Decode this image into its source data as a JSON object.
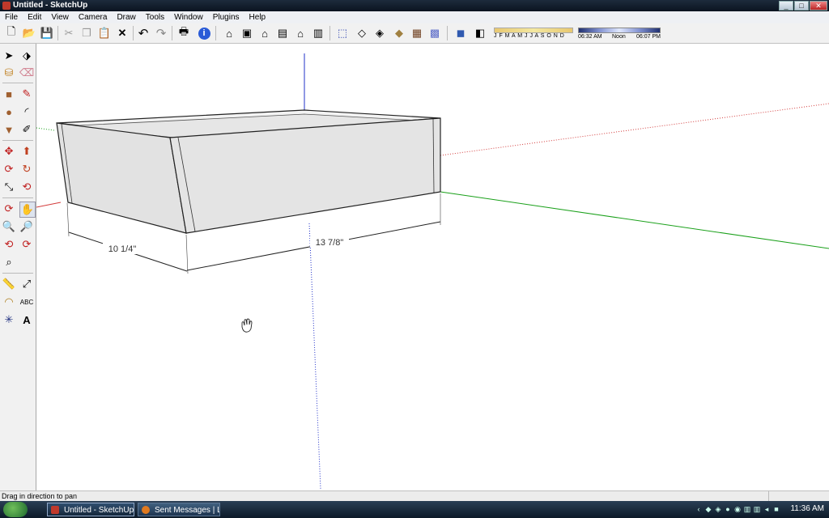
{
  "window": {
    "title": "Untitled - SketchUp"
  },
  "menus": [
    "File",
    "Edit",
    "View",
    "Camera",
    "Draw",
    "Tools",
    "Window",
    "Plugins",
    "Help"
  ],
  "shadow_settings": {
    "months_label": "J F M A M J J A S O N D",
    "time_left": "06:32 AM",
    "time_mid": "Noon",
    "time_right": "06:07 PM"
  },
  "viewport": {
    "dimensions": [
      "10 1/4\"",
      "13 7/8\""
    ],
    "axis_colors": {
      "red": "#d33b3b",
      "green": "#1aa01a",
      "blue": "#2030c8"
    },
    "cursor_icon": "hand-pan-icon"
  },
  "status": {
    "message": "Drag in direction to pan"
  },
  "taskbar": {
    "tasks": [
      "Untitled - SketchUp",
      "Sent Messages | Lu..."
    ],
    "clock": "11:36 AM"
  }
}
